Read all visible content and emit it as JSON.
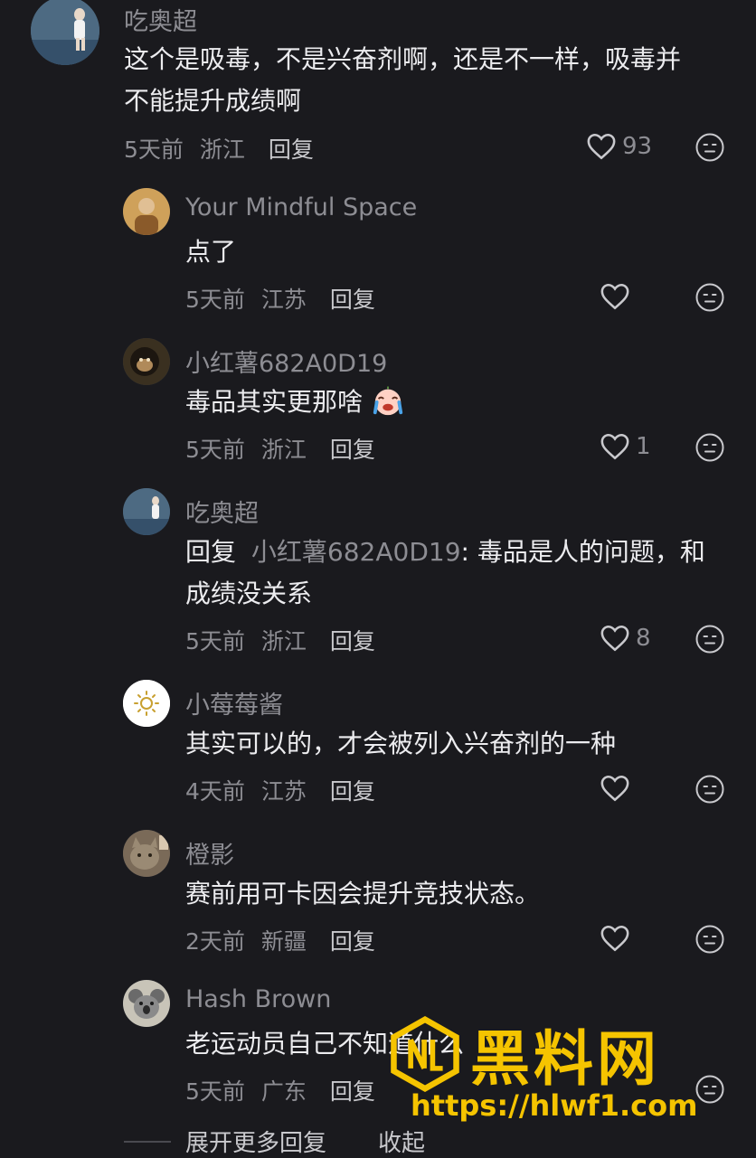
{
  "comments": [
    {
      "username": "吃奥超",
      "lines": [
        "这个是吸毒，不是兴奋剂啊，还是不一样，吸毒并",
        "不能提升成绩啊"
      ],
      "time": "5天前",
      "location": "浙江",
      "reply_label": "回复",
      "likes": "93",
      "avatar_icon": "tennis-player-avatar"
    },
    {
      "username": "Your Mindful Space",
      "lines": [
        "点了"
      ],
      "time": "5天前",
      "location": "江苏",
      "reply_label": "回复",
      "likes": "",
      "avatar_icon": "monk-avatar"
    },
    {
      "username": "小红薯682A0D19",
      "lines": [
        "毒品其实更那啥"
      ],
      "emoji": "crying-face-emoji",
      "time": "5天前",
      "location": "浙江",
      "reply_label": "回复",
      "likes": "1",
      "avatar_icon": "monkey-avatar"
    },
    {
      "username": "吃奥超",
      "reply_prefix": "回复",
      "mention": "小红薯682A0D19",
      "lines": [
        ": 毒品是人的问题，和",
        "成绩没关系"
      ],
      "time": "5天前",
      "location": "浙江",
      "reply_label": "回复",
      "likes": "8",
      "avatar_icon": "tennis-player-avatar"
    },
    {
      "username": "小莓莓酱",
      "lines": [
        "其实可以的，才会被列入兴奋剂的一种"
      ],
      "time": "4天前",
      "location": "江苏",
      "reply_label": "回复",
      "likes": "",
      "avatar_icon": "sun-avatar"
    },
    {
      "username": "橙影",
      "lines": [
        "赛前用可卡因会提升竞技状态。"
      ],
      "time": "2天前",
      "location": "新疆",
      "reply_label": "回复",
      "likes": "",
      "avatar_icon": "cat-avatar"
    },
    {
      "username": "Hash Brown",
      "lines": [
        "老运动员自己不知道什么"
      ],
      "time": "5天前",
      "location": "广东",
      "reply_label": "回复",
      "likes": "",
      "avatar_icon": "koala-avatar"
    }
  ],
  "footer": {
    "expand_label": "展开更多回复",
    "collapse_label": "收起"
  },
  "watermark": {
    "title": "黑料网",
    "url": "https://hlwf1.com",
    "color": "#f5c400"
  },
  "colors": {
    "background": "#1a1a1e",
    "text": "#ececef",
    "muted": "#8d8d93"
  }
}
